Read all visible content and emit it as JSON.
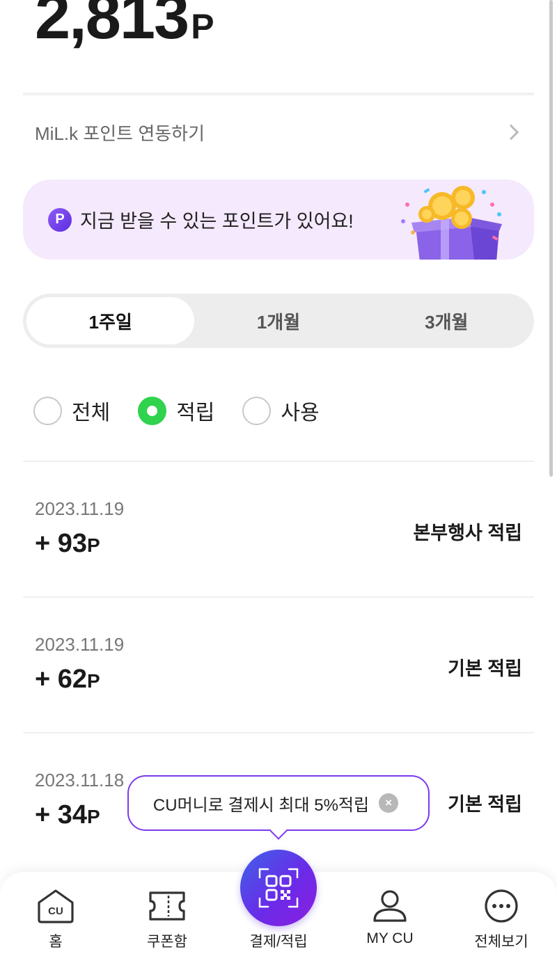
{
  "balance": {
    "value": "2,813",
    "unit": "P"
  },
  "milk_link": {
    "label": "MiL.k 포인트 연동하기"
  },
  "promo": {
    "badge": "P",
    "text": "지금 받을 수 있는 포인트가 있어요!"
  },
  "period_tabs": [
    {
      "label": "1주일",
      "active": true
    },
    {
      "label": "1개월",
      "active": false
    },
    {
      "label": "3개월",
      "active": false
    }
  ],
  "filters": [
    {
      "label": "전체",
      "checked": false
    },
    {
      "label": "적립",
      "checked": true
    },
    {
      "label": "사용",
      "checked": false
    }
  ],
  "history": [
    {
      "date": "2023.11.19",
      "amount": "+ 93",
      "unit": "P",
      "type": "본부행사 적립"
    },
    {
      "date": "2023.11.19",
      "amount": "+ 62",
      "unit": "P",
      "type": "기본 적립"
    },
    {
      "date": "2023.11.18",
      "amount": "+ 34",
      "unit": "P",
      "type": "기본 적립"
    }
  ],
  "tooltip": {
    "text": "CU머니로 결제시 최대 5%적립",
    "close": "×"
  },
  "nav": {
    "home": "홈",
    "coupon": "쿠폰함",
    "pay": "결제/적립",
    "mycu": "MY CU",
    "all": "전체보기",
    "home_icon_text": "CU"
  },
  "colors": {
    "accent": "#7c3aed",
    "radio_checked": "#2fd34d",
    "promo_bg": "#f5e9fd"
  }
}
